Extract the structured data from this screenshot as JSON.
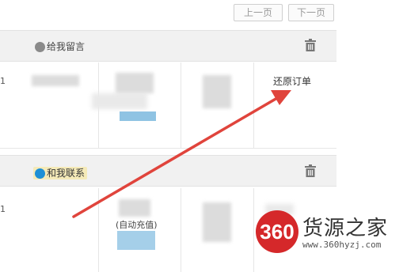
{
  "pagination": {
    "prev_label": "上一页",
    "next_label": "下一页"
  },
  "orders": [
    {
      "row_left": "1",
      "message_link": "给我留言",
      "action_link": "还原订单",
      "fragment": "",
      "tag_text": ""
    },
    {
      "row_left": "1",
      "message_link": "和我联系",
      "action_link": "",
      "fragment": "(自动充值)",
      "tag_text": ""
    }
  ],
  "watermark": {
    "badge_text": "360",
    "brand": "货源之家",
    "url": "www.360hyzj.com"
  },
  "colors": {
    "arrow": "#e0443c",
    "chip_blue": "#1e8fd6",
    "chip_highlight": "#f5eab8",
    "watermark_red": "#d5282a"
  }
}
